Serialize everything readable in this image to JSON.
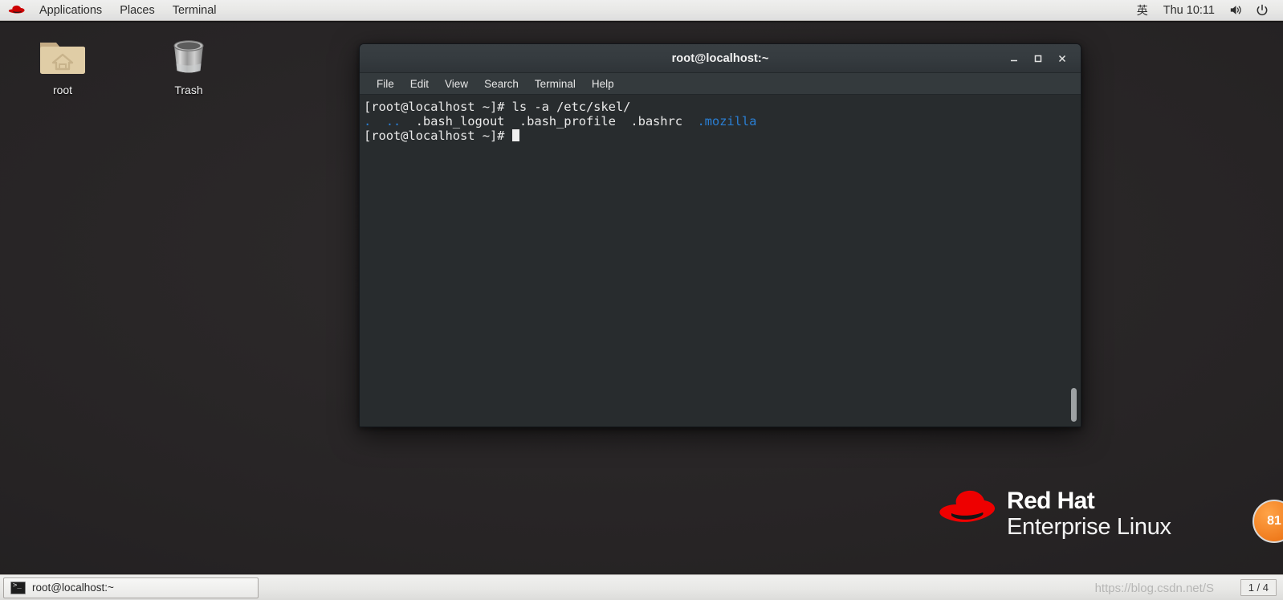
{
  "top_panel": {
    "logo_icon": "redhat-logo-icon",
    "menus": [
      {
        "label": "Applications",
        "name": "applications-menu"
      },
      {
        "label": "Places",
        "name": "places-menu"
      },
      {
        "label": "Terminal",
        "name": "terminal-menu"
      }
    ],
    "input_method": "英",
    "clock": "Thu 10:11",
    "volume_icon": "volume-icon",
    "power_icon": "power-icon"
  },
  "desktop": {
    "icons": [
      {
        "label": "root",
        "icon": "home-folder-icon"
      },
      {
        "label": "Trash",
        "icon": "trash-can-icon"
      }
    ]
  },
  "terminal": {
    "title": "root@localhost:~",
    "window_buttons": {
      "minimize": "–",
      "maximize": "□",
      "close": "✕"
    },
    "menubar": [
      "File",
      "Edit",
      "View",
      "Search",
      "Terminal",
      "Help"
    ],
    "lines": [
      {
        "segments": [
          {
            "text": "[root@localhost ~]# ls -a /etc/skel/",
            "color": "white"
          }
        ]
      },
      {
        "segments": [
          {
            "text": ".",
            "color": "blue"
          },
          {
            "text": "  ",
            "color": "white"
          },
          {
            "text": "..",
            "color": "blue"
          },
          {
            "text": "  .bash_logout  .bash_profile  .bashrc  ",
            "color": "white"
          },
          {
            "text": ".mozilla",
            "color": "blue"
          }
        ]
      },
      {
        "segments": [
          {
            "text": "[root@localhost ~]# ",
            "color": "white"
          }
        ],
        "cursor": true
      }
    ],
    "colors": {
      "background": "#282c2e",
      "foreground": "#e6e6e6",
      "directory_blue": "#2a7fd4"
    }
  },
  "brand": {
    "line1": "Red Hat",
    "line2": "Enterprise Linux",
    "logo_icon": "redhat-fedora-icon",
    "red": "#ee0000"
  },
  "badge": {
    "text": "81",
    "color": "#f07c1e"
  },
  "taskbar": {
    "window_button": {
      "label": "root@localhost:~",
      "icon": "terminal-icon"
    },
    "workspace": "1 / 4"
  },
  "watermark": "https://blog.csdn.net/S"
}
